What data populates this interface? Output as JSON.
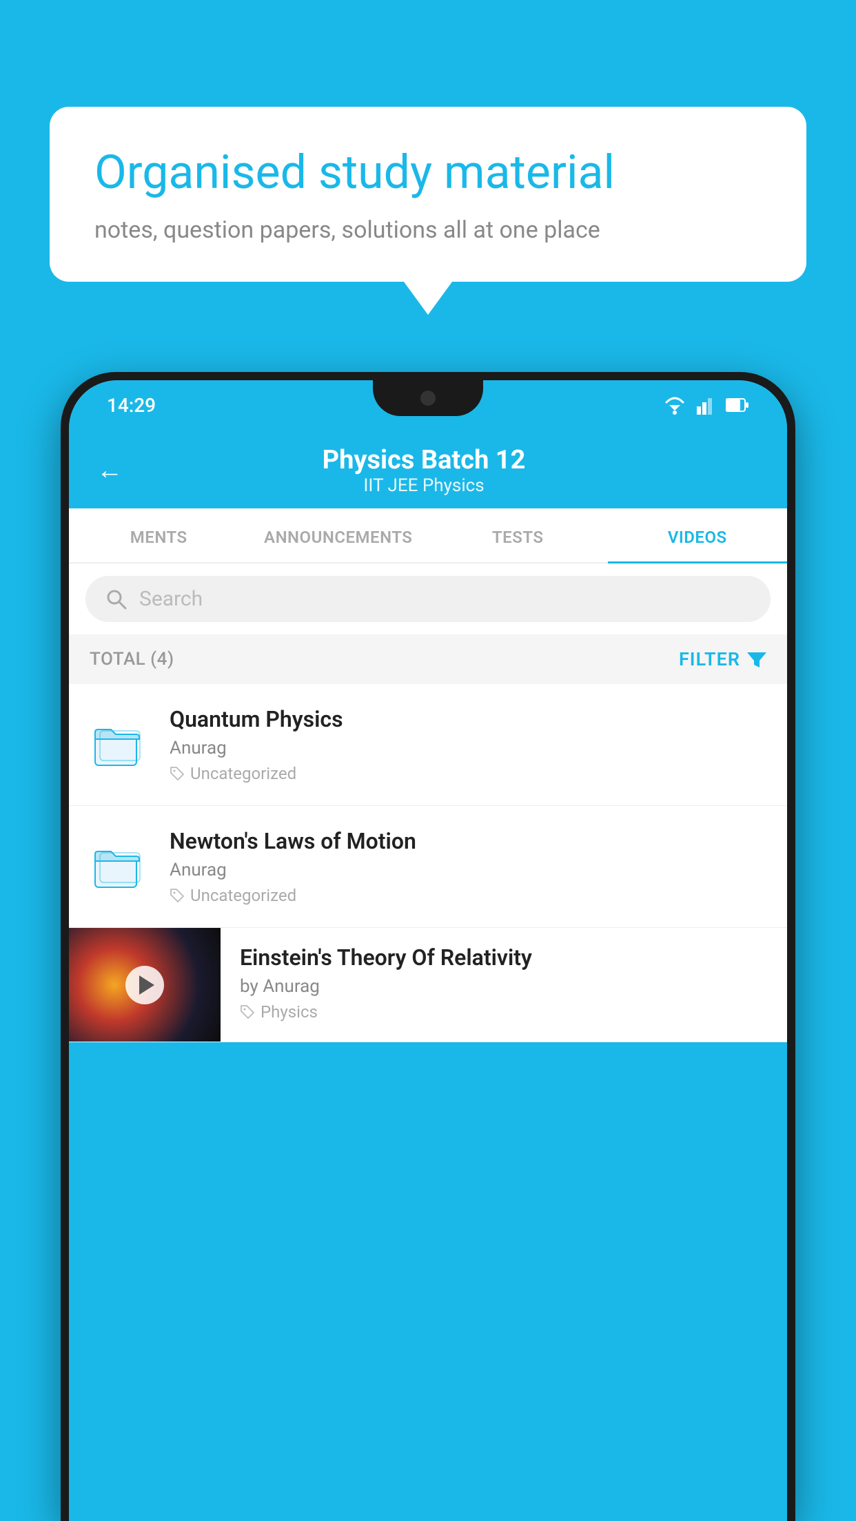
{
  "background_color": "#1ab8e8",
  "speech_bubble": {
    "title": "Organised study material",
    "subtitle": "notes, question papers, solutions all at one place"
  },
  "phone": {
    "status_bar": {
      "time": "14:29"
    },
    "app_header": {
      "title": "Physics Batch 12",
      "subtitle": "IIT JEE   Physics",
      "back_label": "←"
    },
    "tabs": [
      {
        "label": "MENTS",
        "active": false
      },
      {
        "label": "ANNOUNCEMENTS",
        "active": false
      },
      {
        "label": "TESTS",
        "active": false
      },
      {
        "label": "VIDEOS",
        "active": true
      }
    ],
    "search": {
      "placeholder": "Search"
    },
    "filter_row": {
      "total_label": "TOTAL (4)",
      "filter_label": "FILTER"
    },
    "list_items": [
      {
        "title": "Quantum Physics",
        "author": "Anurag",
        "tag": "Uncategorized",
        "type": "folder"
      },
      {
        "title": "Newton's Laws of Motion",
        "author": "Anurag",
        "tag": "Uncategorized",
        "type": "folder"
      }
    ],
    "video_item": {
      "title": "Einstein's Theory Of Relativity",
      "author": "by Anurag",
      "tag": "Physics",
      "type": "video"
    }
  }
}
